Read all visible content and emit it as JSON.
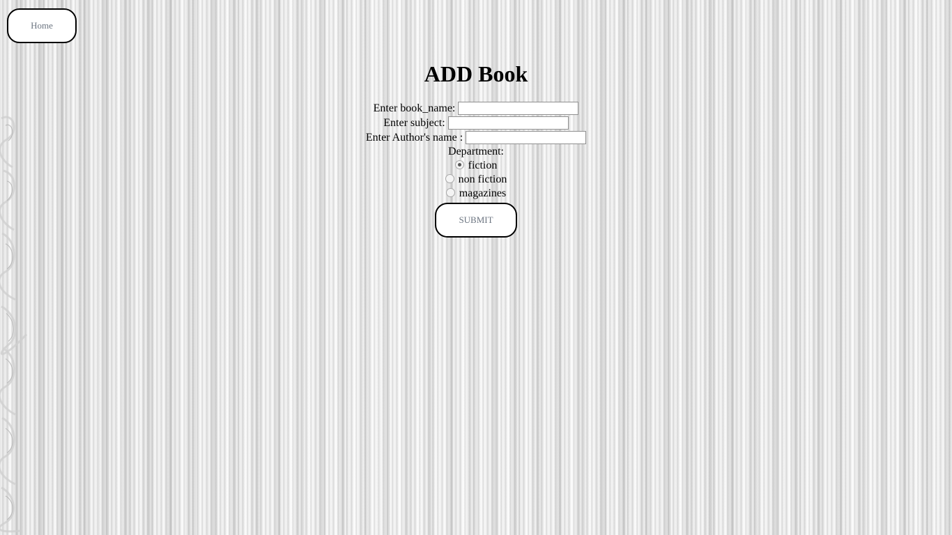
{
  "nav": {
    "home_label": "Home"
  },
  "page": {
    "title": "ADD Book"
  },
  "form": {
    "book_name_label": "Enter book_name:",
    "book_name_value": "",
    "subject_label": "Enter subject:",
    "subject_value": "",
    "author_label": "Enter Author's name :",
    "author_value": "",
    "department_label": "Department:",
    "departments": [
      {
        "label": "fiction",
        "checked": true
      },
      {
        "label": "non fiction",
        "checked": false
      },
      {
        "label": "magazines",
        "checked": false
      }
    ],
    "submit_label": "SUBMIT"
  },
  "colors": {
    "button_text": "#6b7480",
    "button_border": "#000000",
    "background": "#ececec"
  }
}
